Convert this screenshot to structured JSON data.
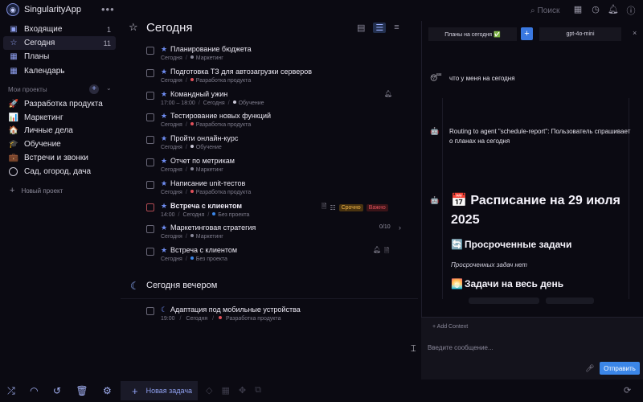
{
  "app": {
    "name": "SingularityApp",
    "menu_glyph": "•••",
    "logo_glyph": "◉"
  },
  "topbar": {
    "search_placeholder": "Поиск",
    "icons": [
      "calendar-icon",
      "timer-icon",
      "bell-icon",
      "info-icon",
      "collapse-icon"
    ]
  },
  "sidebar": {
    "items": [
      {
        "label": "Входящие",
        "count": "1",
        "icon": "inbox-icon",
        "glyph": "▣"
      },
      {
        "label": "Сегодня",
        "count": "11",
        "icon": "star-icon",
        "glyph": "☆",
        "active": true
      },
      {
        "label": "Планы",
        "count": "",
        "icon": "calendar-icon",
        "glyph": "▦"
      },
      {
        "label": "Календарь",
        "count": "",
        "icon": "calendar-icon",
        "glyph": "▦"
      }
    ],
    "projects_header": "Мои проекты",
    "projects": [
      {
        "label": "Разработка продукта",
        "glyph": "🚀"
      },
      {
        "label": "Маркетинг",
        "glyph": "📊"
      },
      {
        "label": "Личные дела",
        "glyph": "🏠"
      },
      {
        "label": "Обучение",
        "glyph": "🎓"
      },
      {
        "label": "Встречи и звонки",
        "glyph": "💼"
      },
      {
        "label": "Сад, огород, дача",
        "glyph": ""
      }
    ],
    "new_project": "Новый проект"
  },
  "main": {
    "title": "Сегодня",
    "tasks": [
      {
        "title": "Планирование бюджета",
        "time": "",
        "date": "Сегодня",
        "project": "Маркетинг",
        "dot": "#8a8a9a"
      },
      {
        "title": "Подготовка ТЗ для автозагрузки серверов",
        "time": "",
        "date": "Сегодня",
        "project": "Разработка продукта",
        "dot": "#e0505a"
      },
      {
        "title": "Командный ужин",
        "time": "17:00 – 18:00",
        "date": "Сегодня",
        "project": "Обучение",
        "dot": "#c8c6d4"
      },
      {
        "title": "Тестирование новых функций",
        "time": "",
        "date": "Сегодня",
        "project": "Разработка продукта",
        "dot": "#e0505a"
      },
      {
        "title": "Пройти онлайн-курс",
        "time": "",
        "date": "Сегодня",
        "project": "Обучение",
        "dot": "#c8c6d4"
      },
      {
        "title": "Отчет по метрикам",
        "time": "",
        "date": "Сегодня",
        "project": "Маркетинг",
        "dot": "#8a8a9a"
      },
      {
        "title": "Написание unit-тестов",
        "time": "",
        "date": "Сегодня",
        "project": "Разработка продукта",
        "dot": "#e0505a"
      },
      {
        "title": "Встреча с клиентом",
        "time": "14:00",
        "date": "Сегодня",
        "project": "Без проекта",
        "dot": "#3b86e8",
        "urgent": "Срочно",
        "important": "Важно"
      },
      {
        "title": "Маркетинговая стратегия",
        "time": "",
        "date": "Сегодня",
        "project": "Маркетинг",
        "dot": "#8a8a9a",
        "progress": "0/10"
      },
      {
        "title": "Встреча с клиентом",
        "time": "",
        "date": "Сегодня",
        "project": "Без проекта",
        "dot": "#3b86e8"
      }
    ],
    "evening_title": "Сегодня вечером",
    "evening_task": {
      "title": "Адаптация под мобильные устройства",
      "time": "19:00",
      "date": "Сегодня",
      "project": "Разработка продукта",
      "dot": "#e0505a"
    }
  },
  "bottombar": {
    "new_task": "Новая задача"
  },
  "chat": {
    "tab1": "Планы на сегодня ✅",
    "tab_plus": "+",
    "model": "gpt-4o-mini",
    "close": "×",
    "user_msg": "что у меня на сегодня",
    "bot_msg": "Routing to agent \"schedule-report\": Пользователь спрашивает о планах на сегодня",
    "schedule_title": "📅 Расписание на 29 июля 2025",
    "overdue_title": "Просроченные задачи",
    "overdue_note": "Просроченных задач нет",
    "allday_title": "Задачи на весь день",
    "add_context": "+ Add Context",
    "input_placeholder": "Введите сообщение...",
    "send": "Отправить"
  }
}
